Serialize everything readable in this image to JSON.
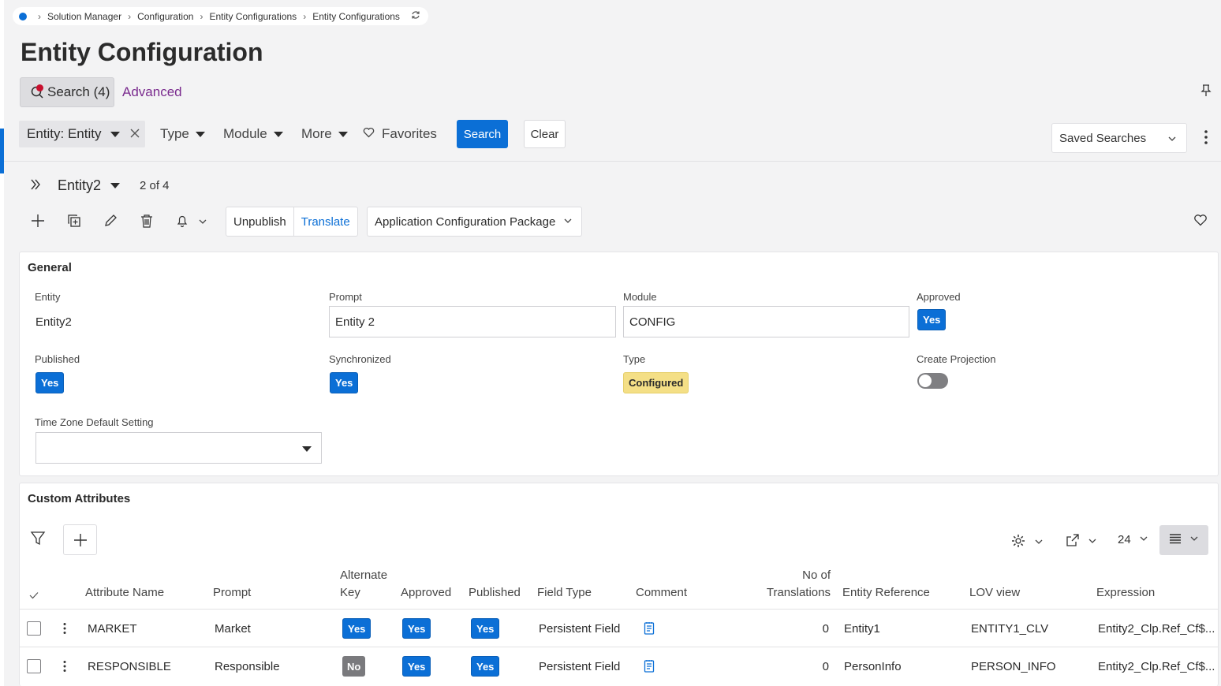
{
  "breadcrumb": {
    "items": [
      "Solution Manager",
      "Configuration",
      "Entity Configurations",
      "Entity Configurations"
    ]
  },
  "page": {
    "title": "Entity Configuration"
  },
  "search": {
    "tab_label": "Search (4)",
    "advanced_label": "Advanced",
    "entity_chip": "Entity: Entity",
    "dropdowns": [
      "Type",
      "Module",
      "More"
    ],
    "favorites_label": "Favorites",
    "search_button": "Search",
    "clear_button": "Clear",
    "saved_searches": "Saved Searches"
  },
  "record": {
    "name": "Entity2",
    "count": "2 of 4"
  },
  "toolbar": {
    "unpublish": "Unpublish",
    "translate": "Translate",
    "package": "Application Configuration Package"
  },
  "general": {
    "title": "General",
    "entity_label": "Entity",
    "entity_value": "Entity2",
    "prompt_label": "Prompt",
    "prompt_value": "Entity 2",
    "module_label": "Module",
    "module_value": "CONFIG",
    "approved_label": "Approved",
    "approved_value": "Yes",
    "published_label": "Published",
    "published_value": "Yes",
    "synchronized_label": "Synchronized",
    "synchronized_value": "Yes",
    "type_label": "Type",
    "type_value": "Configured",
    "create_projection_label": "Create Projection",
    "create_projection_on": false,
    "timezone_label": "Time Zone Default Setting",
    "timezone_value": ""
  },
  "custom": {
    "title": "Custom Attributes",
    "page_size": "24",
    "headers": {
      "attribute_name": "Attribute Name",
      "prompt": "Prompt",
      "alternate_key_1": "Alternate",
      "alternate_key_2": "Key",
      "approved": "Approved",
      "published": "Published",
      "field_type": "Field Type",
      "comment": "Comment",
      "translations_1": "No of",
      "translations_2": "Translations",
      "entity_reference": "Entity Reference",
      "lov_view": "LOV view",
      "expression": "Expression"
    },
    "rows": [
      {
        "attribute_name": "MARKET",
        "prompt": "Market",
        "alternate_key": "Yes",
        "approved": "Yes",
        "published": "Yes",
        "field_type": "Persistent Field",
        "translations": "0",
        "entity_reference": "Entity1",
        "lov_view": "ENTITY1_CLV",
        "expression": "Entity2_Clp.Ref_Cf$..."
      },
      {
        "attribute_name": "RESPONSIBLE",
        "prompt": "Responsible",
        "alternate_key": "No",
        "approved": "Yes",
        "published": "Yes",
        "field_type": "Persistent Field",
        "translations": "0",
        "entity_reference": "PersonInfo",
        "lov_view": "PERSON_INFO",
        "expression": "Entity2_Clp.Ref_Cf$..."
      }
    ]
  },
  "colors": {
    "accent": "#0b6fd6",
    "advanced_link": "#7a2b8e",
    "configured_badge": "#f4df86",
    "no_badge": "#7a7a7d"
  }
}
